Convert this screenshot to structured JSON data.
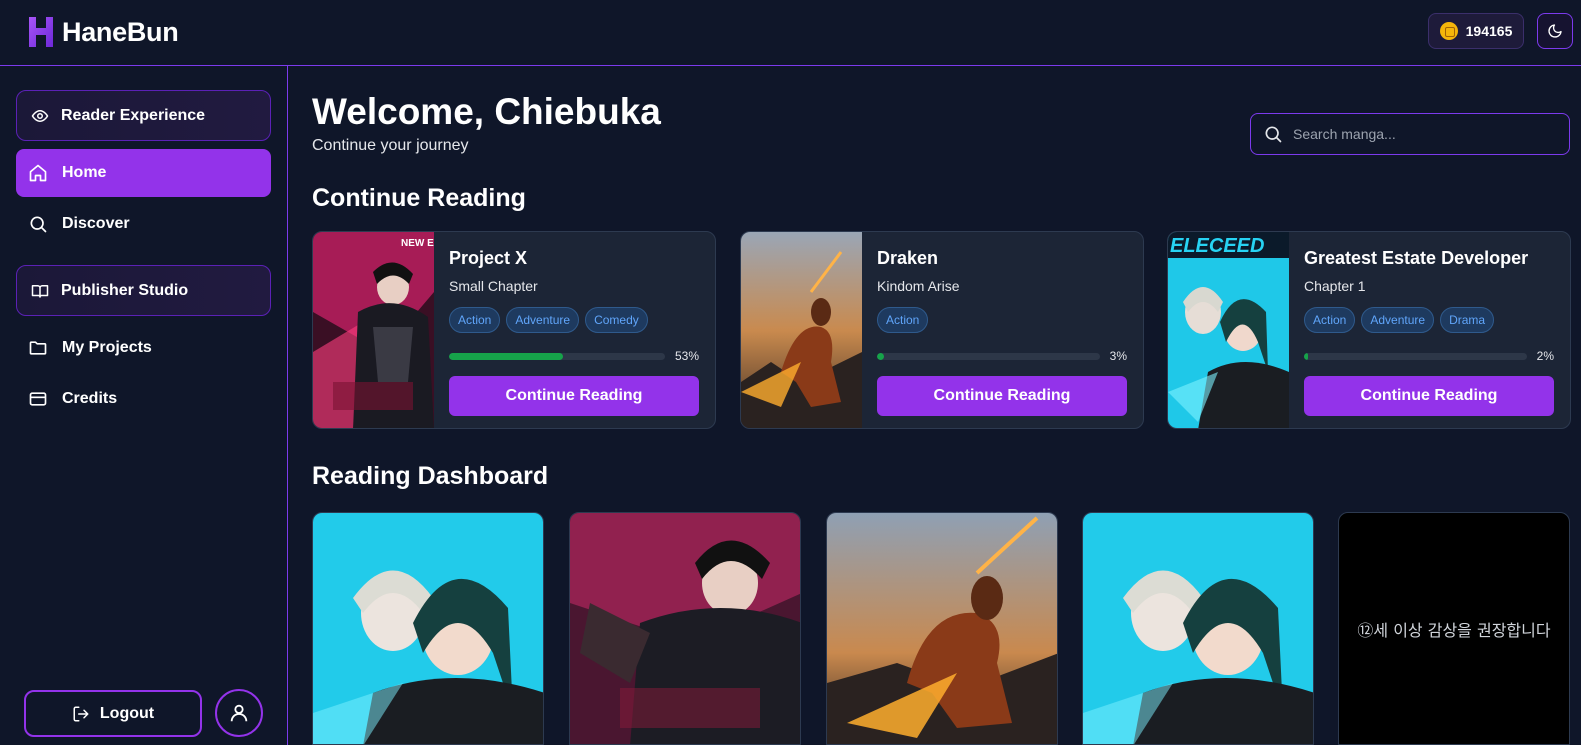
{
  "app": {
    "name": "HaneBun",
    "credits": "194165"
  },
  "sidebar": {
    "reader_section": "Reader Experience",
    "nav": [
      {
        "label": "Home",
        "icon": "home-icon",
        "active": true
      },
      {
        "label": "Discover",
        "icon": "search-icon"
      }
    ],
    "publisher_section": "Publisher Studio",
    "publisher_nav": [
      {
        "label": "My Projects",
        "icon": "folder-icon"
      },
      {
        "label": "Credits",
        "icon": "credit-card-icon"
      }
    ],
    "logout_label": "Logout"
  },
  "main": {
    "welcome": "Welcome, Chiebuka",
    "subtitle": "Continue your journey",
    "search_placeholder": "Search manga...",
    "continue_title": "Continue Reading",
    "dashboard_title": "Reading Dashboard"
  },
  "continue_reading": [
    {
      "title": "Project X",
      "chapter": "Small Chapter",
      "tags": [
        "Action",
        "Adventure",
        "Comedy"
      ],
      "progress": 53,
      "progress_label": "53%",
      "button": "Continue Reading",
      "cover": "dark-warrior-cover",
      "cover_text": "NEW EPISODE"
    },
    {
      "title": "Draken",
      "chapter": "Kindom Arise",
      "tags": [
        "Action"
      ],
      "progress": 3,
      "progress_label": "3%",
      "button": "Continue Reading",
      "cover": "dragon-rider-cover"
    },
    {
      "title": "Greatest Estate Developer",
      "chapter": "Chapter 1",
      "tags": [
        "Action",
        "Adventure",
        "Drama"
      ],
      "progress": 2,
      "progress_label": "2%",
      "button": "Continue Reading",
      "cover": "two-characters-cover",
      "cover_text": "ELECEED"
    }
  ],
  "dashboard": [
    {
      "cover": "two-characters-cover"
    },
    {
      "cover": "dark-warrior-cover"
    },
    {
      "cover": "dragon-rider-cover"
    },
    {
      "cover": "two-characters-cover"
    },
    {
      "cover": "age-warning-cover",
      "text": "⑫세 이상 감상을 권장합니다"
    }
  ],
  "colors": {
    "accent": "#9333ea",
    "background": "#0f1629",
    "card": "#1c2536",
    "progress": "#16a34a",
    "tag": "#60a5fa"
  }
}
